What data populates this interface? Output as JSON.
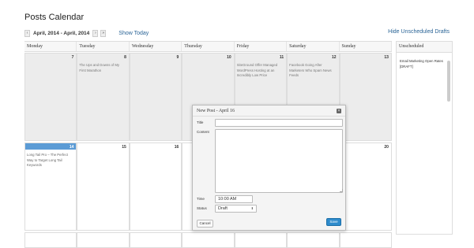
{
  "page": {
    "title": "Posts Calendar"
  },
  "nav": {
    "prev_icon": "‹",
    "range": "April, 2014 - April, 2014",
    "next_icon": "›",
    "fast_forward_icon": "»",
    "show_today": "Show Today",
    "hide_drafts": "Hide Unscheduled Drafts"
  },
  "calendar": {
    "headers": [
      "Monday",
      "Tuesday",
      "Wednesday",
      "Thursday",
      "Friday",
      "Saturday",
      "Sunday"
    ],
    "week1": {
      "days": [
        "7",
        "8",
        "9",
        "10",
        "11",
        "12",
        "13"
      ],
      "posts": {
        "tue": "The Ups and Downs of My First Marathon",
        "fri": "SiteGround Offer Managed WordPress Hosting at an Incredibly Low Price",
        "sat": "Facebook Going After Marketers Who Spam News Feeds"
      }
    },
    "week2": {
      "days": [
        "14",
        "15",
        "16",
        "",
        "",
        "",
        "20"
      ],
      "posts": {
        "mon": "Long Tail Pro – The Perfect Way to Target Long Tail Keywords"
      }
    }
  },
  "unscheduled": {
    "header": "Unscheduled",
    "item": "Email Marketing Open Rates [DRAFT]"
  },
  "modal": {
    "title": "New Post - April 16",
    "close_icon": "×",
    "title_label": "Title",
    "title_value": "",
    "content_label": "Content",
    "content_value": "",
    "time_label": "Time",
    "time_value": "10:00 AM",
    "status_label": "Status",
    "status_value": "Draft",
    "status_arrow": "⬍",
    "cancel_label": "Cancel",
    "save_label": "Save"
  },
  "colors": {
    "link": "#2a6496",
    "today": "#5b9bd5",
    "save": "#2e8bcc"
  }
}
